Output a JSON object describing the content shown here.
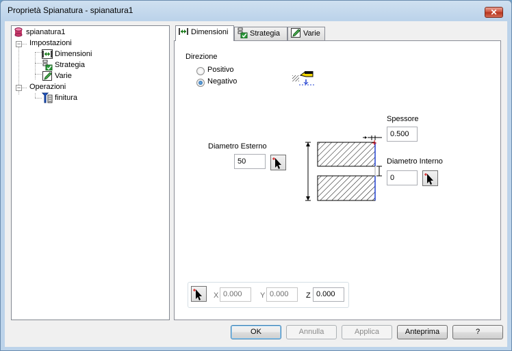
{
  "window": {
    "title": "Proprietà Spianatura - spianatura1",
    "close_label": "✕"
  },
  "tree": {
    "root": "spianatura1",
    "impostazioni": "Impostazioni",
    "dimensioni": "Dimensioni",
    "strategia": "Strategia",
    "varie": "Varie",
    "operazioni": "Operazioni",
    "finitura": "finitura",
    "expander_symbol": "−"
  },
  "tabs": [
    {
      "label": "Dimensioni",
      "active": true
    },
    {
      "label": "Strategia",
      "active": false
    },
    {
      "label": "Varie",
      "active": false
    }
  ],
  "direzione": {
    "label": "Direzione",
    "options": [
      "Positivo",
      "Negativo"
    ],
    "selected": "Negativo"
  },
  "fields": {
    "spessore_label": "Spessore",
    "spessore_value": "0.500",
    "diam_esterno_label": "Diametro Esterno",
    "diam_esterno_value": "50",
    "diam_interno_label": "Diametro Interno",
    "diam_interno_value": "0"
  },
  "coords": {
    "x_label": "X",
    "x_value": "0.000",
    "y_label": "Y",
    "y_value": "0.000",
    "z_label": "Z",
    "z_value": "0.000"
  },
  "buttons": {
    "ok": "OK",
    "annulla": "Annulla",
    "applica": "Applica",
    "anteprima": "Anteprima",
    "help": "?"
  },
  "colors": {
    "accent": "#3c7fb1",
    "hatch": "#000000",
    "marker_blue": "#1f3fd0",
    "marker_red": "#d40000"
  }
}
